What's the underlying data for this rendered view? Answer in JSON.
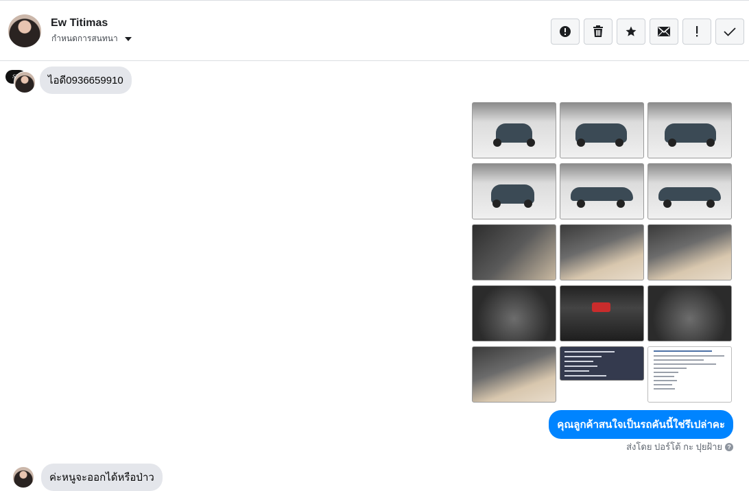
{
  "header": {
    "name": "Ew Titimas",
    "subtitle": "กำหนดการสนทนา",
    "actions": [
      {
        "icon": "alert-circle-icon",
        "label": "report"
      },
      {
        "icon": "trash-icon",
        "label": "delete"
      },
      {
        "icon": "star-icon",
        "label": "star"
      },
      {
        "icon": "envelope-icon",
        "label": "mark unread"
      },
      {
        "icon": "exclamation-icon",
        "label": "important"
      },
      {
        "icon": "checkmark-icon",
        "label": "done"
      }
    ]
  },
  "messages": {
    "first_incoming": "ไอดี0936659910",
    "outgoing": "คุณลูกค้าสนใจเป็นรถคันนี้ใช่รึเปล่าคะ",
    "sent_by": "ส่งโดย ปอร์โต้ กะ ปุยฝ้าย",
    "last_incoming": "ค่ะหนูจะออกได้หรือป่าว"
  },
  "page_logo_text": "SK",
  "attachments": [
    {
      "kind": "car-front"
    },
    {
      "kind": "car-front-angle"
    },
    {
      "kind": "car-rear-angle"
    },
    {
      "kind": "car-rear"
    },
    {
      "kind": "car-side"
    },
    {
      "kind": "car-side-angle"
    },
    {
      "kind": "door-interior"
    },
    {
      "kind": "dashboard-interior"
    },
    {
      "kind": "gear-shift-interior"
    },
    {
      "kind": "engine-bay"
    },
    {
      "kind": "center-console"
    },
    {
      "kind": "engine-close"
    },
    {
      "kind": "rear-seats"
    },
    {
      "kind": "spec-sheet-dark"
    },
    {
      "kind": "post-screenshot"
    }
  ],
  "colors": {
    "accent": "#0084ff",
    "incoming_bubble": "#e4e6eb",
    "border": "#dadde1"
  }
}
